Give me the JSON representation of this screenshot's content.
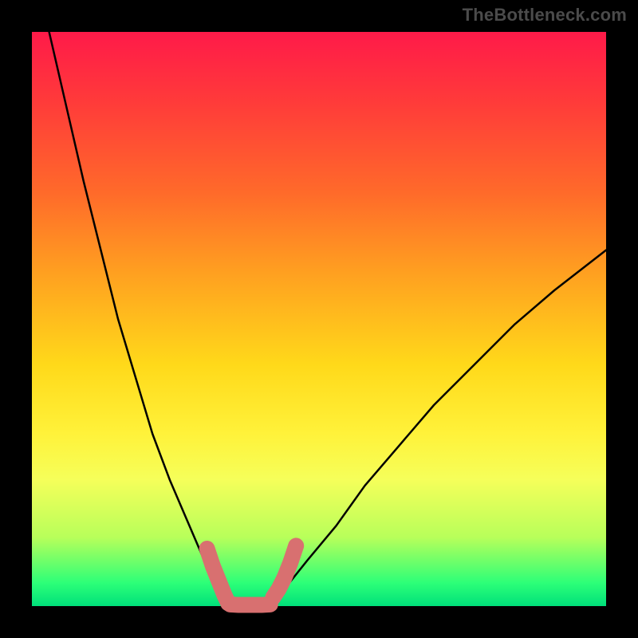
{
  "watermark": "TheBottleneck.com",
  "chart_data": {
    "type": "line",
    "title": "",
    "xlabel": "",
    "ylabel": "",
    "xlim": [
      0,
      100
    ],
    "ylim": [
      0,
      100
    ],
    "grid": false,
    "series": [
      {
        "name": "left-branch",
        "stroke": "#000000",
        "x": [
          3,
          6,
          9,
          12,
          15,
          18,
          21,
          24,
          27,
          30,
          32,
          34,
          35
        ],
        "y": [
          100,
          87,
          74,
          62,
          50,
          40,
          30,
          22,
          15,
          8,
          4,
          1.5,
          0
        ]
      },
      {
        "name": "right-branch",
        "stroke": "#000000",
        "x": [
          41,
          44,
          48,
          53,
          58,
          64,
          70,
          77,
          84,
          91,
          100
        ],
        "y": [
          0,
          3,
          8,
          14,
          21,
          28,
          35,
          42,
          49,
          55,
          62
        ]
      },
      {
        "name": "valley-floor",
        "stroke": "#000000",
        "x": [
          35,
          36,
          37,
          38,
          39,
          40,
          41
        ],
        "y": [
          0,
          0,
          0,
          0,
          0,
          0,
          0
        ]
      },
      {
        "name": "highlight-left-wall",
        "stroke": "#d87070",
        "x": [
          30.5,
          31.5,
          32.5,
          33.5,
          34.2
        ],
        "y": [
          10,
          7,
          4.5,
          2,
          0.5
        ]
      },
      {
        "name": "highlight-floor",
        "stroke": "#d87070",
        "x": [
          34.5,
          36,
          38,
          40,
          41.5
        ],
        "y": [
          0.3,
          0.2,
          0.2,
          0.2,
          0.3
        ]
      },
      {
        "name": "highlight-right-wall",
        "stroke": "#d87070",
        "x": [
          42,
          43,
          44,
          45,
          46
        ],
        "y": [
          1.5,
          3,
          5,
          7.5,
          10.5
        ]
      }
    ],
    "background_gradient": {
      "direction": "top-to-bottom",
      "stops": [
        {
          "pos": 0.0,
          "color": "#ff1a49"
        },
        {
          "pos": 0.12,
          "color": "#ff3a3a"
        },
        {
          "pos": 0.28,
          "color": "#ff6a2a"
        },
        {
          "pos": 0.42,
          "color": "#ffa020"
        },
        {
          "pos": 0.58,
          "color": "#ffd91a"
        },
        {
          "pos": 0.7,
          "color": "#fff23a"
        },
        {
          "pos": 0.78,
          "color": "#f5ff5a"
        },
        {
          "pos": 0.88,
          "color": "#b8ff5a"
        },
        {
          "pos": 0.96,
          "color": "#2cff78"
        },
        {
          "pos": 1.0,
          "color": "#00e07a"
        }
      ]
    }
  }
}
